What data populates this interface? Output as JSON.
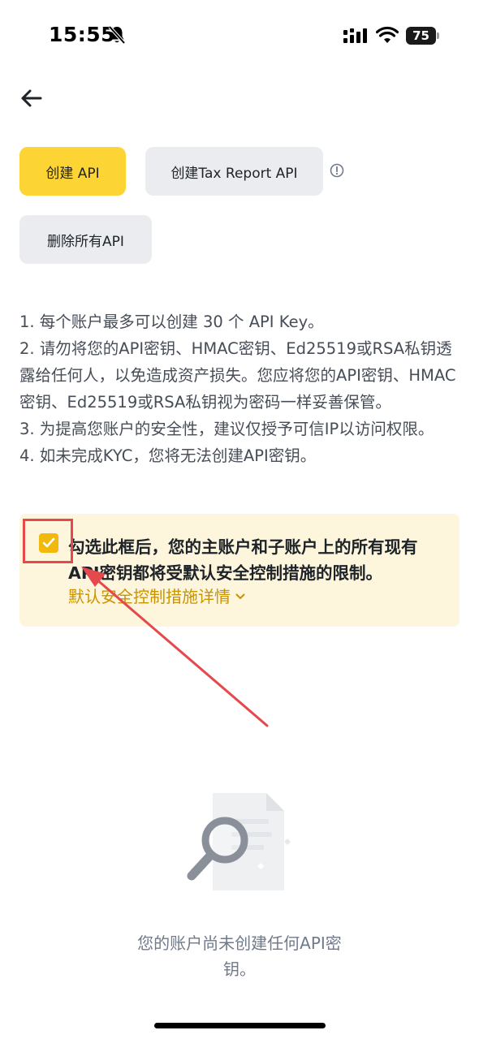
{
  "status_bar": {
    "time": "15:55",
    "battery_level": "75",
    "icons": [
      "bell-slash-icon",
      "signal-icon",
      "wifi-icon",
      "battery-icon"
    ]
  },
  "toolbar": {
    "back_icon": "arrow-left-icon"
  },
  "actions": {
    "create_api_label": "创建 API",
    "create_tax_api_label": "创建Tax Report API",
    "delete_all_label": "删除所有API",
    "info_icon": "info-circle-icon"
  },
  "notes": [
    "1. 每个账户最多可以创建 30 个 API Key。",
    "2. 请勿将您的API密钥、HMAC密钥、Ed25519或RSA私钥透露给任何人，以免造成资产损失。您应将您的API密钥、HMAC密钥、Ed25519或RSA私钥视为密码一样妥善保管。",
    "3. 为提高您账户的安全性，建议仅授予可信IP以访问权限。",
    "4. 如未完成KYC，您将无法创建API密钥。"
  ],
  "warning": {
    "checked": true,
    "text": "勾选此框后，您的主账户和子账户上的所有现有API密钥都将受默认安全控制措施的限制。",
    "details_link": "默认安全控制措施详情"
  },
  "empty_state": {
    "illustration_icon": "document-search-icon",
    "message": "您的账户尚未创建任何API密钥。"
  },
  "colors": {
    "primary": "#fcd535",
    "secondary_button": "#eaecef",
    "warning_bg": "#fdf6dc",
    "link": "#c99400",
    "annotation": "#e5484d"
  }
}
